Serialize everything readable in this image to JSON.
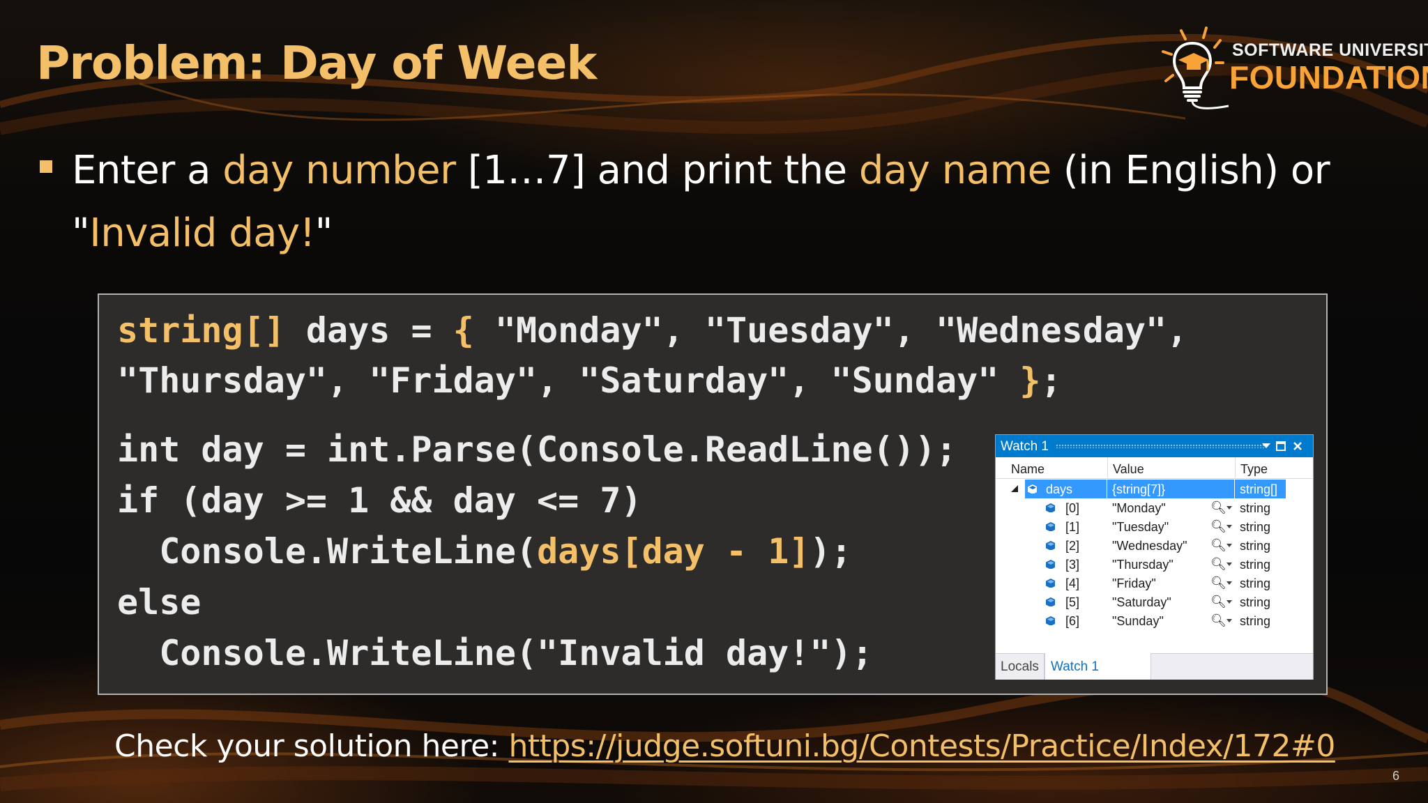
{
  "slide": {
    "title": "Problem: Day of Week",
    "page_number": "6"
  },
  "logo": {
    "line1": "SOFTWARE UNIVERSITY",
    "line2": "FOUNDATION"
  },
  "bullet": {
    "p1": "Enter a ",
    "h1": "day number",
    "p2": " [1…7] and print the ",
    "h2": "day name",
    "p3": " (in English) or \"",
    "h3": "Invalid day!",
    "p4": "\""
  },
  "code": {
    "l1_kw": "string[]",
    "l1_a": " days = ",
    "l1_brace": "{",
    "l1_b": " \"Monday\", \"Tuesday\", \"Wednesday\",",
    "l2_a": "\"Thursday\", \"Friday\", \"Saturday\", \"Sunday\" ",
    "l2_brace": "}",
    "l2_b": ";",
    "l3": "int day = int.Parse(Console.ReadLine());",
    "l4": "if (day >= 1 && day <= 7)",
    "l5_a": "  Console.WriteLine(",
    "l5_hl": "days[day - 1]",
    "l5_b": ");",
    "l6": "else",
    "l7": "  Console.WriteLine(\"Invalid day!\");"
  },
  "watch": {
    "title": "Watch 1",
    "headers": {
      "name": "Name",
      "value": "Value",
      "type": "Type"
    },
    "root": {
      "name": "days",
      "value": "{string[7]}",
      "type": "string[]"
    },
    "items": [
      {
        "name": "[0]",
        "value": "\"Monday\"",
        "type": "string"
      },
      {
        "name": "[1]",
        "value": "\"Tuesday\"",
        "type": "string"
      },
      {
        "name": "[2]",
        "value": "\"Wednesday\"",
        "type": "string"
      },
      {
        "name": "[3]",
        "value": "\"Thursday\"",
        "type": "string"
      },
      {
        "name": "[4]",
        "value": "\"Friday\"",
        "type": "string"
      },
      {
        "name": "[5]",
        "value": "\"Saturday\"",
        "type": "string"
      },
      {
        "name": "[6]",
        "value": "\"Sunday\"",
        "type": "string"
      }
    ],
    "tabs": [
      "Locals",
      "Watch 1"
    ],
    "active_tab": "Watch 1"
  },
  "footer": {
    "prefix": "Check your solution here: ",
    "link": "https://judge.softuni.bg/Contests/Practice/Index/172#0"
  },
  "colors": {
    "accent": "#f3c069",
    "code_bg": "#2d2c2a",
    "watch_titlebar": "#007acc",
    "watch_selection": "#3399ff",
    "logo_orange": "#f7a337"
  },
  "icons": {
    "bullet": "square-bullet-icon",
    "logo": "lightbulb-graduation-cap-icon",
    "expand": "collapse-triangle-icon",
    "variable": "field-cube-icon",
    "magnifier": "magnifier-icon",
    "dropdown": "dropdown-arrow-icon",
    "maximize": "maximize-icon",
    "close": "close-icon"
  }
}
